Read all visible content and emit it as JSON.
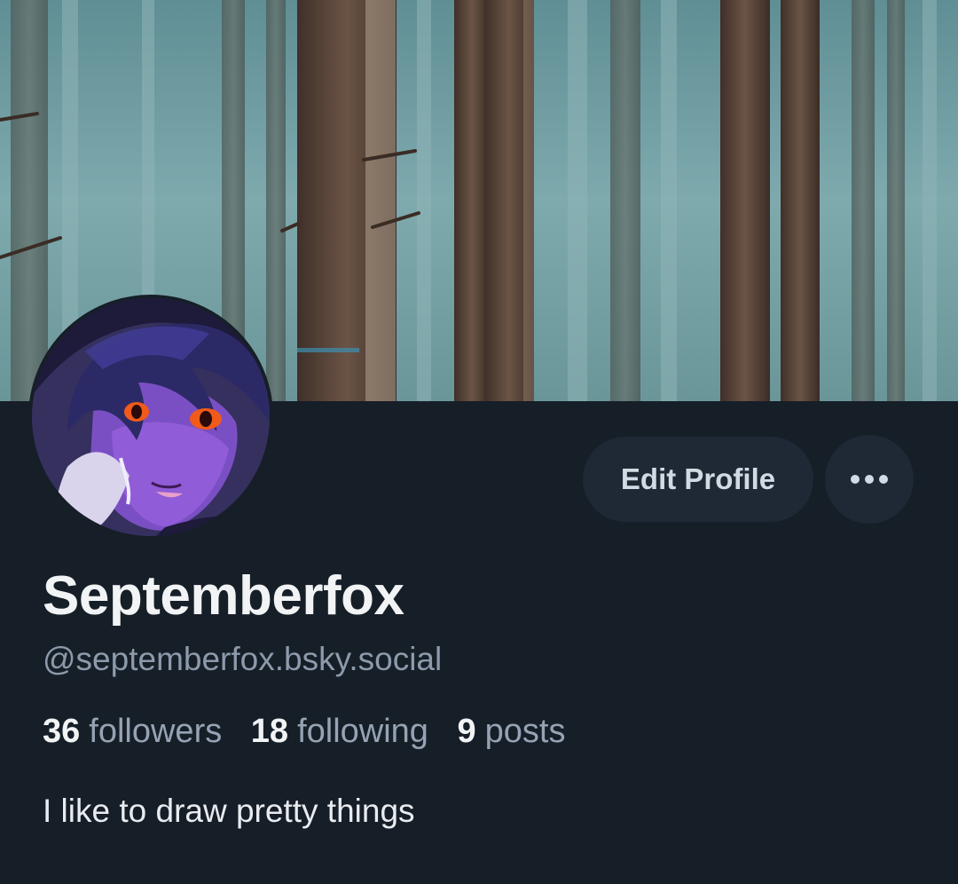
{
  "profile": {
    "display_name": "Septemberfox",
    "handle": "@septemberfox.bsky.social",
    "bio": "I like to draw pretty things",
    "banner_image": "misty-forest-banner",
    "avatar_image": "purple-fox-character-avatar"
  },
  "actions": {
    "edit_label": "Edit Profile",
    "more_icon": "more-horizontal-icon"
  },
  "stats": {
    "followers_count": "36",
    "followers_label": "followers",
    "following_count": "18",
    "following_label": "following",
    "posts_count": "9",
    "posts_label": "posts"
  },
  "colors": {
    "background": "#161e27",
    "button_bg": "#1e2935",
    "text_primary": "#f1f3f5",
    "text_secondary": "#8c9aab"
  }
}
